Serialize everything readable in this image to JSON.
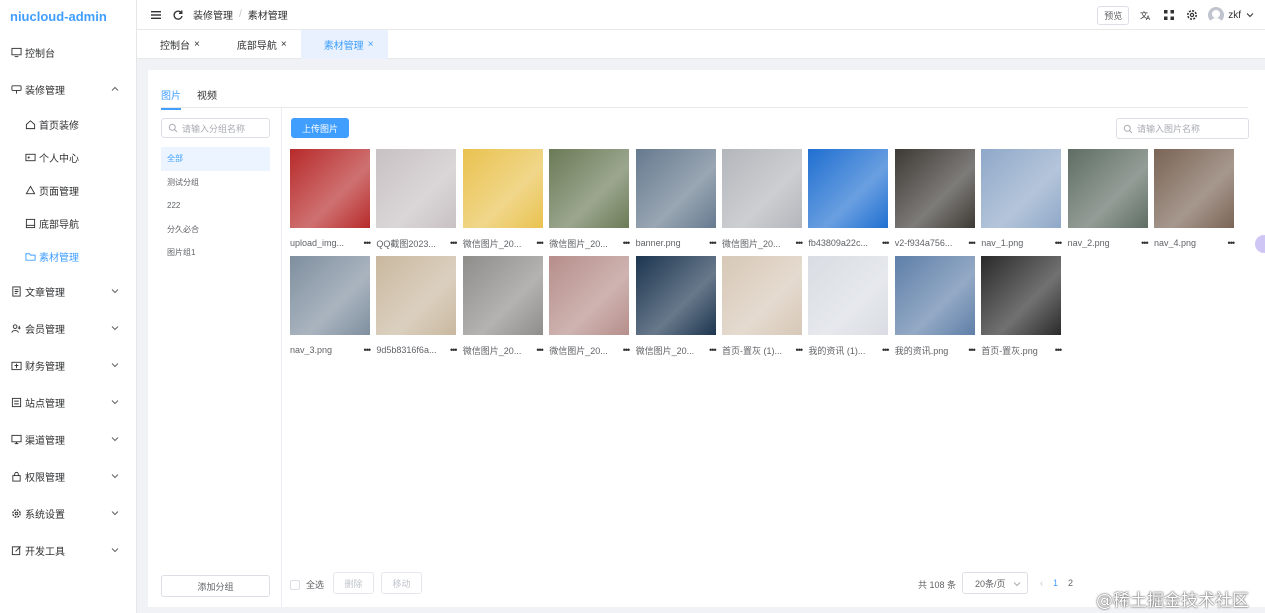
{
  "app": {
    "title": "niucloud-admin"
  },
  "sidebar": {
    "items": [
      {
        "label": "控制台",
        "icon": "monitor-icon",
        "expandable": false
      },
      {
        "label": "装修管理",
        "icon": "palette-icon",
        "expandable": true,
        "expanded": true,
        "children": [
          {
            "label": "首页装修",
            "icon": "home-icon"
          },
          {
            "label": "个人中心",
            "icon": "card-icon"
          },
          {
            "label": "页面管理",
            "icon": "share-icon"
          },
          {
            "label": "底部导航",
            "icon": "window-icon"
          },
          {
            "label": "素材管理",
            "icon": "folder-icon",
            "active": true
          }
        ]
      },
      {
        "label": "文章管理",
        "icon": "document-icon",
        "expandable": true
      },
      {
        "label": "会员管理",
        "icon": "users-icon",
        "expandable": true
      },
      {
        "label": "财务管理",
        "icon": "wallet-icon",
        "expandable": true
      },
      {
        "label": "站点管理",
        "icon": "list-icon",
        "expandable": true
      },
      {
        "label": "渠道管理",
        "icon": "screen-icon",
        "expandable": true
      },
      {
        "label": "权限管理",
        "icon": "lock-icon",
        "expandable": true
      },
      {
        "label": "系统设置",
        "icon": "gear-icon",
        "expandable": true
      },
      {
        "label": "开发工具",
        "icon": "edit-icon",
        "expandable": true
      }
    ]
  },
  "topbar": {
    "breadcrumb": [
      "装修管理",
      "素材管理"
    ],
    "separator": "/",
    "preview_label": "预览",
    "username": "zkf"
  },
  "tabs": [
    {
      "label": "控制台",
      "close": "×"
    },
    {
      "label": "底部导航",
      "close": "×"
    },
    {
      "label": "素材管理",
      "close": "×",
      "active": true
    }
  ],
  "media": {
    "tabs": [
      "图片",
      "视频"
    ],
    "active_tab": "图片",
    "group_search_placeholder": "请输入分组名称",
    "groups": [
      "全部",
      "测试分组",
      "222",
      "分久必合",
      "图片组1"
    ],
    "add_group_label": "添加分组",
    "upload_label": "上传图片",
    "image_search_placeholder": "请输入图片名称",
    "images": [
      {
        "name": "upload_img...",
        "color": "#b72a2a"
      },
      {
        "name": "QQ截图2023...",
        "color": "#c8c1c4"
      },
      {
        "name": "微信图片_20...",
        "color": "#e9c24f"
      },
      {
        "name": "微信图片_20...",
        "color": "#6a7a56"
      },
      {
        "name": "banner.png",
        "color": "#667a8e"
      },
      {
        "name": "微信图片_20...",
        "color": "#b3b6bb"
      },
      {
        "name": "fb43809a22c...",
        "color": "#1f6fd1"
      },
      {
        "name": "v2-f934a756...",
        "color": "#3d3a35"
      },
      {
        "name": "nav_1.png",
        "color": "#8fa8c8"
      },
      {
        "name": "nav_2.png",
        "color": "#5e6d63"
      },
      {
        "name": "nav_4.png",
        "color": "#7a6455"
      },
      {
        "name": "nav_3.png",
        "color": "#7f8f9f"
      },
      {
        "name": "9d5b8316f6a...",
        "color": "#c9b89f"
      },
      {
        "name": "微信图片_20...",
        "color": "#8e8d8a"
      },
      {
        "name": "微信图片_20...",
        "color": "#b68e8a"
      },
      {
        "name": "微信图片_20...",
        "color": "#1c3550"
      },
      {
        "name": "首页-置灰 (1)...",
        "color": "#d7c8b7"
      },
      {
        "name": "我的资讯 (1)...",
        "color": "#d9dde3"
      },
      {
        "name": "我的资讯.png",
        "color": "#5e7fa8"
      },
      {
        "name": "首页-置灰.png",
        "color": "#2a2a2a"
      }
    ],
    "more_icon": "•••",
    "select_all_label": "全选",
    "delete_label": "删除",
    "move_label": "移动",
    "total_label": "共 108 条",
    "page_size_label": "20条/页",
    "pages": [
      "1",
      "2"
    ],
    "current_page": "1",
    "prev_symbol": "‹"
  },
  "watermark": "@稀土掘金技术社区",
  "colors": {
    "primary": "#409eff",
    "sidebar_bg": "#ffffff",
    "page_bg": "#f0f2f5"
  }
}
